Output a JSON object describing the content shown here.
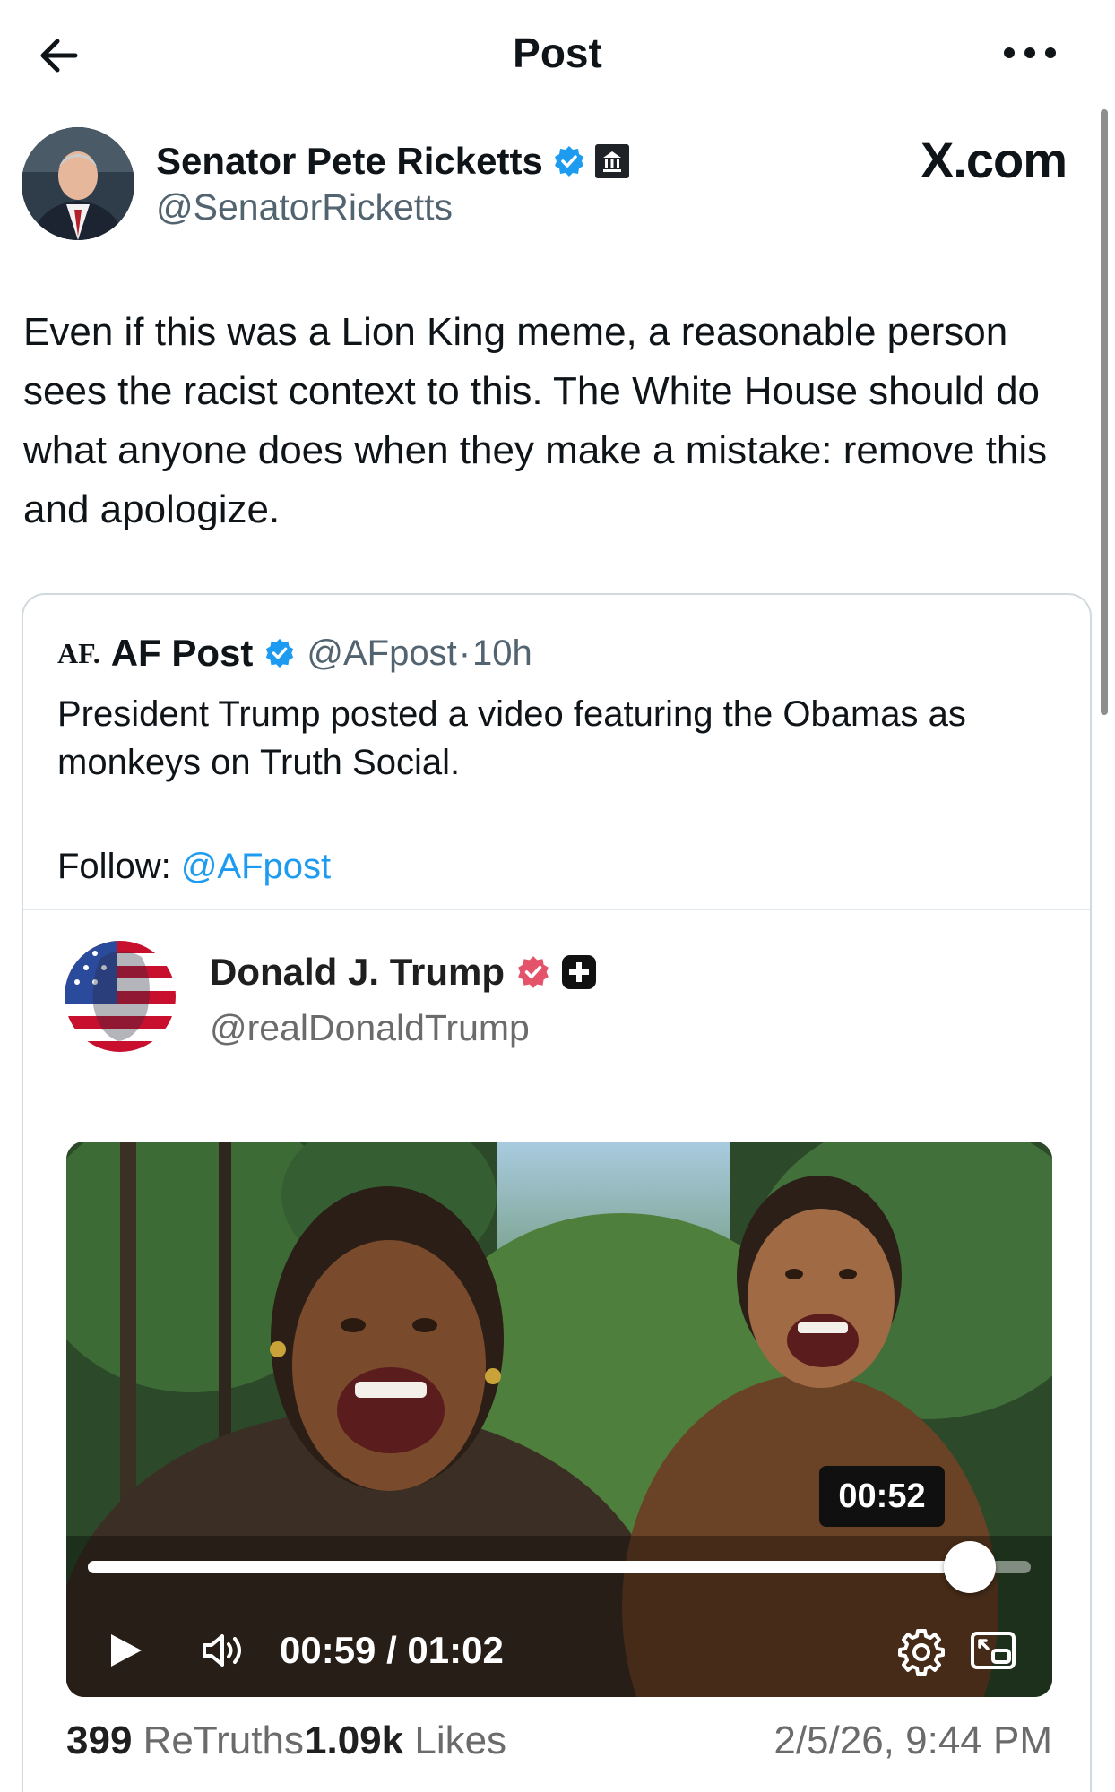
{
  "header": {
    "title": "Post",
    "back_icon": "arrow-left-icon",
    "more_icon": "more-horizontal-icon"
  },
  "author": {
    "name": "Senator Pete Ricketts",
    "handle": "@SenatorRicketts",
    "verified_icon": "verified-badge-icon",
    "affiliation_icon": "government-building-icon"
  },
  "brand": {
    "label": "X.com"
  },
  "post": {
    "text": "Even if this was a Lion King meme, a reasonable person sees the racist context to this. The White House should do what anyone does when they make a mistake: remove this and apologize."
  },
  "quote": {
    "logo": "AF.",
    "name": "AF Post",
    "handle": "@AFpost",
    "separator": "·",
    "age": "10h",
    "text": "President Trump posted a video featuring the Obamas as monkeys on Truth Social.",
    "follow_label": "Follow:",
    "follow_link": "@AFpost"
  },
  "truth": {
    "name": "Donald J. Trump",
    "handle": "@realDonaldTrump",
    "verified_icon": "verified-badge-icon",
    "platform_icon": "truth-social-plus-icon",
    "video": {
      "tooltip_time": "00:52",
      "time_display": "00:59 / 01:02",
      "progress": 0.935,
      "play_icon": "play-icon",
      "volume_icon": "volume-icon",
      "settings_icon": "gear-icon",
      "pip_icon": "picture-in-picture-icon"
    },
    "stats": {
      "retruths_count": "399",
      "retruths_label": "ReTruths",
      "likes_count": "1.09k",
      "likes_label": "Likes",
      "timestamp": "2/5/26, 9:44 PM"
    }
  },
  "colors": {
    "text_primary": "#0f1419",
    "text_secondary": "#536471",
    "link": "#1d9bf0",
    "verified_blue": "#1d9bf0",
    "truth_verified": "#e3546b",
    "border": "#cfd9de"
  }
}
